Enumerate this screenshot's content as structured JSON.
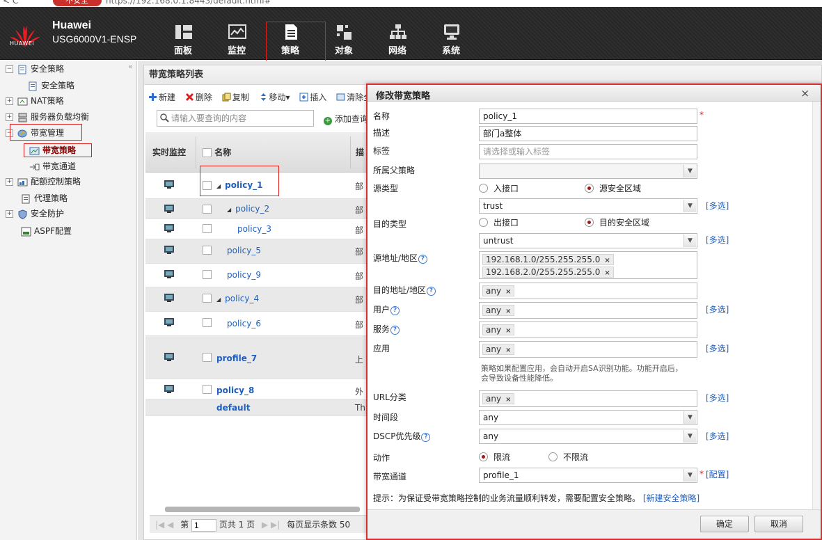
{
  "browser": {
    "nav": "< C",
    "security_badge": "不安全",
    "url": "https://192.168.0.1:8443/default.html#"
  },
  "header": {
    "logo_text": "HUAWEI",
    "brand_name": "Huawei",
    "device_model": "USG6000V1-ENSP",
    "nav": [
      {
        "label": "面板",
        "icon": "dashboard-icon"
      },
      {
        "label": "监控",
        "icon": "monitor-icon"
      },
      {
        "label": "策略",
        "icon": "policy-document-icon",
        "active": true
      },
      {
        "label": "对象",
        "icon": "object-icon"
      },
      {
        "label": "网络",
        "icon": "network-icon"
      },
      {
        "label": "系统",
        "icon": "system-icon"
      }
    ]
  },
  "sidebar": {
    "items": [
      {
        "label": "安全策略",
        "expander": "−"
      },
      {
        "label": "安全策略"
      },
      {
        "label": "NAT策略",
        "expander": "+"
      },
      {
        "label": "服务器负载均衡",
        "expander": "+"
      },
      {
        "label": "带宽管理",
        "expander": "−"
      },
      {
        "label": "带宽策略",
        "selected": true
      },
      {
        "label": "带宽通道"
      },
      {
        "label": "配额控制策略",
        "expander": "+"
      },
      {
        "label": "代理策略"
      },
      {
        "label": "安全防护",
        "expander": "+"
      },
      {
        "label": "ASPF配置"
      }
    ],
    "collapse_glyph": "«"
  },
  "panel": {
    "title": "带宽策略列表",
    "toolbar": {
      "new": "新建",
      "delete": "删除",
      "copy": "复制",
      "move": "移动▾",
      "insert": "插入",
      "clear_all": "清除全"
    },
    "search_placeholder": "请输入要查询的内容",
    "add_query": "添加查询",
    "columns": {
      "monitor": "实时监控",
      "name": "名称",
      "desc": "描"
    },
    "rows": [
      {
        "name": "policy_1",
        "desc": "部",
        "expand": "◢"
      },
      {
        "name": "policy_2",
        "desc": "部",
        "expand": "◢"
      },
      {
        "name": "policy_3",
        "desc": "部"
      },
      {
        "name": "policy_5",
        "desc": "部"
      },
      {
        "name": "policy_9",
        "desc": "部"
      },
      {
        "name": "policy_4",
        "desc": "部",
        "expand": "◢"
      },
      {
        "name": "policy_6",
        "desc": "部"
      },
      {
        "name": "profile_7",
        "desc": "上"
      },
      {
        "name": "policy_8",
        "desc": "外"
      },
      {
        "name": "default",
        "desc": "Th"
      }
    ],
    "pager": {
      "page_label": "第",
      "page_value": "1",
      "total": "页共 1 页",
      "per_page_label": "每页显示条数",
      "per_page_value": "50"
    }
  },
  "modal": {
    "title": "修改带宽策略",
    "close": "×",
    "fields": {
      "name": {
        "label": "名称",
        "value": "policy_1",
        "required": "*"
      },
      "desc": {
        "label": "描述",
        "value": "部门a整体"
      },
      "tag": {
        "label": "标签",
        "placeholder": "请选择或输入标签"
      },
      "parent": {
        "label": "所属父策略",
        "value": ""
      },
      "src_type": {
        "label": "源类型",
        "opt1": "入接口",
        "opt2": "源安全区域"
      },
      "src_zone": {
        "value": "trust",
        "more": "[多选]"
      },
      "dst_type": {
        "label": "目的类型",
        "opt1": "出接口",
        "opt2": "目的安全区域"
      },
      "dst_zone": {
        "value": "untrust",
        "more": "[多选]"
      },
      "src_addr": {
        "label": "源地址/地区",
        "tags": [
          "192.168.1.0/255.255.255.0",
          "192.168.2.0/255.255.255.0"
        ]
      },
      "dst_addr": {
        "label": "目的地址/地区",
        "tag": "any"
      },
      "user": {
        "label": "用户",
        "tag": "any",
        "more": "[多选]"
      },
      "service": {
        "label": "服务",
        "tag": "any"
      },
      "app": {
        "label": "应用",
        "tag": "any",
        "more": "[多选]"
      },
      "app_note": "策略如果配置应用，会自动开启SA识别功能。功能开启后，会导致设备性能降低。",
      "url": {
        "label": "URL分类",
        "tag": "any",
        "more": "[多选]"
      },
      "time": {
        "label": "时间段",
        "value": "any"
      },
      "dscp": {
        "label": "DSCP优先级",
        "value": "any",
        "more": "[多选]"
      },
      "action": {
        "label": "动作",
        "opt1": "限流",
        "opt2": "不限流"
      },
      "channel": {
        "label": "带宽通道",
        "value": "profile_1",
        "required": "*",
        "config": "[配置]"
      }
    },
    "tip_text": "提示：为保证受带宽策略控制的业务流量顺利转发，需要配置安全策略。",
    "tip_link": "[新建安全策略]",
    "ok": "确定",
    "cancel": "取消"
  },
  "colors": {
    "header_bg": "#2b2b2b",
    "link": "#1f5fbf",
    "highlight": "#e02020",
    "radio_on": "#a01818"
  }
}
